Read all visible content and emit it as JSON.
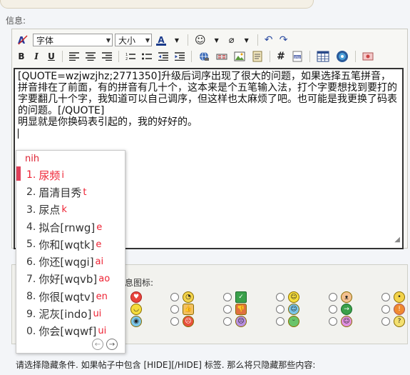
{
  "page": {
    "info_label": "信息:"
  },
  "toolbar": {
    "font_select": "字体",
    "size_select": "大小",
    "font_color_glyph": "A",
    "bold": "B",
    "italic": "I",
    "underline": "U",
    "hash": "#",
    "php": "php"
  },
  "editor": {
    "text": "[QUOTE=wzjwzjhz;2771350]升级后词序出现了很大的问题，如果选择五笔拼音，拼音排在了前面，有的拼音有几十个，这本来是个五笔输入法，打个字要想找到要打的字要翻几十个字，我知道可以自己调序，但这样也太麻烦了吧。也可能是我更换了码表的问题。[/QUOTE]\n明显就是你换码表引起的，我的好好的。\n"
  },
  "ime": {
    "pinyin": "nih",
    "candidates": [
      {
        "num": "1.",
        "text": "尿频",
        "hint": "i"
      },
      {
        "num": "2.",
        "text": "眉清目秀",
        "hint": "t"
      },
      {
        "num": "3.",
        "text": "尿点",
        "hint": "k"
      },
      {
        "num": "4.",
        "text": "拟合[rnwg]",
        "hint": "e"
      },
      {
        "num": "5.",
        "text": "你和[wqtk]",
        "hint": "e"
      },
      {
        "num": "6.",
        "text": "你还[wqgi]",
        "hint": "ai"
      },
      {
        "num": "7.",
        "text": "你好[wqvb]",
        "hint": "ao"
      },
      {
        "num": "8.",
        "text": "你很[wqtv]",
        "hint": "en"
      },
      {
        "num": "9.",
        "text": "泥灰[indo]",
        "hint": "ui"
      },
      {
        "num": "0.",
        "text": "你会[wqwf]",
        "hint": "ui"
      }
    ],
    "prev": "←",
    "next": "→"
  },
  "mood": {
    "label": "息图标:"
  },
  "hide": {
    "text": "请选择隐藏条件. 如果帖子中包含 [HIDE][/HIDE] 标签. 那么将只隐藏那些内容:"
  },
  "colors": {
    "accent": "#e23c3c",
    "editor_border": "#333333",
    "panel_bg": "#f7f7f4"
  }
}
